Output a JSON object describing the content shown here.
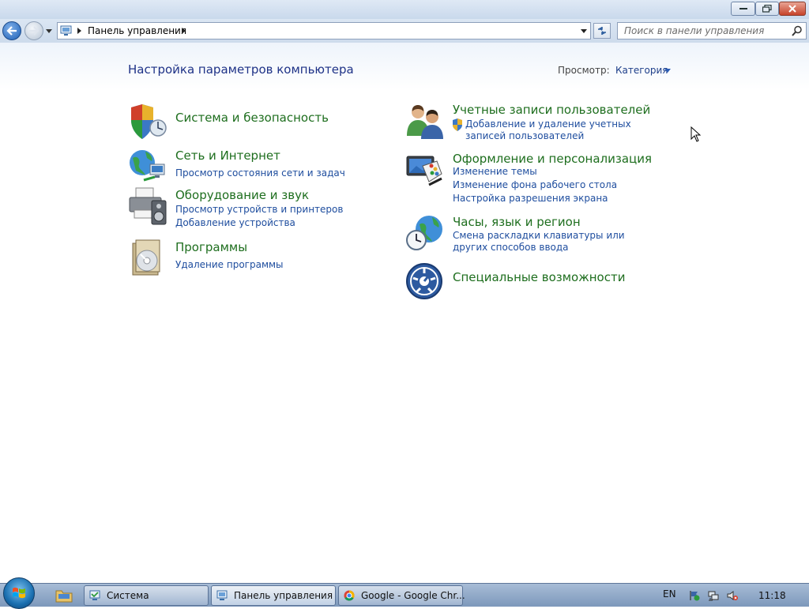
{
  "window": {
    "address_path": "Панель управления",
    "search_placeholder": "Поиск в панели управления"
  },
  "page": {
    "title": "Настройка параметров компьютера",
    "view_label": "Просмотр:",
    "view_value": "Категория"
  },
  "categories_left": [
    {
      "title": "Система и безопасность",
      "icon": "shield-icon",
      "links": []
    },
    {
      "title": "Сеть и Интернет",
      "icon": "network-globe-icon",
      "links": [
        "Просмотр состояния сети и задач"
      ]
    },
    {
      "title": "Оборудование и звук",
      "icon": "printer-speaker-icon",
      "links": [
        "Просмотр устройств и принтеров",
        "Добавление устройства"
      ]
    },
    {
      "title": "Программы",
      "icon": "programs-disc-icon",
      "links": [
        "Удаление программы"
      ]
    }
  ],
  "categories_right": [
    {
      "title": "Учетные записи пользователей",
      "icon": "users-icon",
      "links": [
        "Добавление и удаление учетных записей пользователей"
      ]
    },
    {
      "title": "Оформление и персонализация",
      "icon": "monitor-palette-icon",
      "links": [
        "Изменение темы",
        "Изменение фона рабочего стола",
        "Настройка разрешения экрана"
      ]
    },
    {
      "title": "Часы, язык и регион",
      "icon": "clock-globe-icon",
      "links": [
        "Смена раскладки клавиатуры или других способов ввода"
      ]
    },
    {
      "title": "Специальные возможности",
      "icon": "accessibility-icon",
      "links": []
    }
  ],
  "taskbar": {
    "tasks": [
      {
        "label": "Система",
        "icon": "system-icon"
      },
      {
        "label": "Панель управления",
        "icon": "control-panel-icon"
      },
      {
        "label": "Google - Google Chr...",
        "icon": "chrome-icon"
      }
    ],
    "language": "EN",
    "time": "11:18"
  },
  "colors": {
    "title_text": "#1e3287",
    "category_title": "#1e6e1e",
    "link": "#1e4d9e"
  }
}
